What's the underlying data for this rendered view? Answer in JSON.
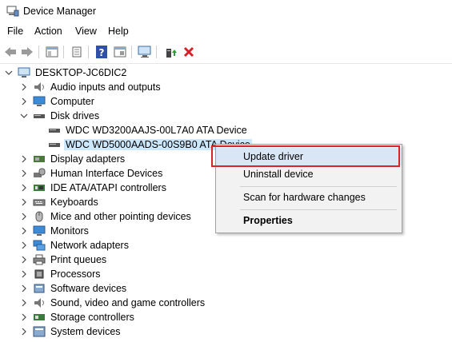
{
  "window": {
    "title": "Device Manager"
  },
  "menu": [
    "File",
    "Action",
    "View",
    "Help"
  ],
  "toolbar": {
    "icons": [
      "back-icon",
      "forward-icon",
      "show-hide-console-tree-icon",
      "properties-icon",
      "help-icon",
      "view-icon",
      "scan-hardware-icon",
      "update-driver-icon",
      "uninstall-icon"
    ]
  },
  "tree": {
    "root": "DESKTOP-JC6DIC2",
    "items": [
      {
        "label": "Audio inputs and outputs",
        "icon": "speaker-icon"
      },
      {
        "label": "Computer",
        "icon": "monitor-icon"
      },
      {
        "label": "Disk drives",
        "icon": "disk-drive-icon",
        "expanded": true,
        "children": [
          {
            "label": "WDC WD3200AAJS-00L7A0 ATA Device",
            "icon": "disk-drive-icon"
          },
          {
            "label": "WDC WD5000AADS-00S9B0 ATA Device",
            "icon": "disk-drive-icon",
            "selected": true
          }
        ]
      },
      {
        "label": "Display adapters",
        "icon": "display-adapter-icon"
      },
      {
        "label": "Human Interface Devices",
        "icon": "hid-icon"
      },
      {
        "label": "IDE ATA/ATAPI controllers",
        "icon": "ide-controller-icon"
      },
      {
        "label": "Keyboards",
        "icon": "keyboard-icon"
      },
      {
        "label": "Mice and other pointing devices",
        "icon": "mouse-icon"
      },
      {
        "label": "Monitors",
        "icon": "monitor-icon"
      },
      {
        "label": "Network adapters",
        "icon": "network-adapter-icon"
      },
      {
        "label": "Print queues",
        "icon": "printer-icon"
      },
      {
        "label": "Processors",
        "icon": "processor-icon"
      },
      {
        "label": "Software devices",
        "icon": "software-device-icon"
      },
      {
        "label": "Sound, video and game controllers",
        "icon": "speaker-icon"
      },
      {
        "label": "Storage controllers",
        "icon": "storage-controller-icon"
      },
      {
        "label": "System devices",
        "icon": "system-devices-icon"
      }
    ]
  },
  "context_menu": {
    "items": [
      {
        "label": "Update driver",
        "highlighted": true
      },
      {
        "label": "Uninstall device"
      },
      {
        "label": "Scan for hardware changes"
      },
      {
        "label": "Properties",
        "bold": true
      }
    ]
  },
  "colors": {
    "selection": "#cce8ff",
    "highlight_border": "#d9252a",
    "menu_bg": "#f2f2f2"
  }
}
